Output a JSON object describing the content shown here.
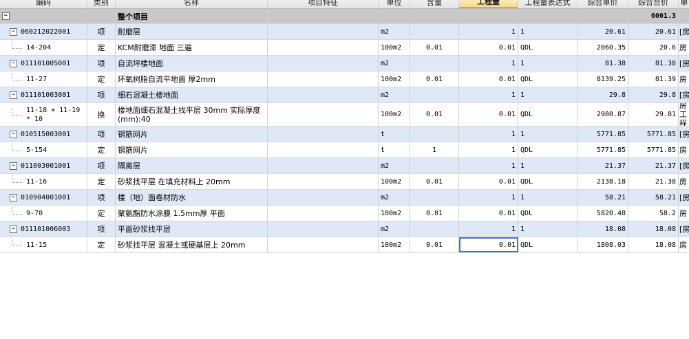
{
  "header": {
    "columns": [
      "编码",
      "类别",
      "名称",
      "项目特征",
      "单位",
      "含量",
      "工程量",
      "工程量表达式",
      "综合单价",
      "综合合价",
      "单"
    ],
    "selected_index": 6
  },
  "project_row": {
    "toggle": "−",
    "name": "整个项目",
    "total": "6001.3"
  },
  "rows": [
    {
      "level": 1,
      "code": "060212022001",
      "type": "项",
      "name": "耐磨层",
      "feature": "",
      "unit": "m2",
      "content": "",
      "qty": "1",
      "expr": "1",
      "price": "20.61",
      "total": "20.61",
      "extra": "[房"
    },
    {
      "level": 2,
      "code": "14-204",
      "type": "定",
      "name": "KCM耐磨漆 地面 三遍",
      "feature": "",
      "unit": "100m2",
      "content": "0.01",
      "qty": "0.01",
      "expr": "QDL",
      "price": "2060.35",
      "total": "20.6",
      "extra": "房"
    },
    {
      "level": 1,
      "code": "011101005001",
      "type": "项",
      "name": "自流坪楼地面",
      "feature": "",
      "unit": "m2",
      "content": "",
      "qty": "1",
      "expr": "1",
      "price": "81.38",
      "total": "81.38",
      "extra": "[房"
    },
    {
      "level": 2,
      "code": "11-27",
      "type": "定",
      "name": "环氧树脂自流平地面 厚2mm",
      "feature": "",
      "unit": "100m2",
      "content": "0.01",
      "qty": "0.01",
      "expr": "QDL",
      "price": "8139.25",
      "total": "81.39",
      "extra": "房"
    },
    {
      "level": 1,
      "code": "011101003001",
      "type": "项",
      "name": "细石混凝土楼地面",
      "feature": "",
      "unit": "m2",
      "content": "",
      "qty": "1",
      "expr": "1",
      "price": "29.8",
      "total": "29.8",
      "extra": "[房"
    },
    {
      "level": 2,
      "tall": true,
      "code": "11-18 + 11-19 * 10",
      "type": "换",
      "name": "楼地面细石混凝土找平层 30mm  实际厚度(mm):40",
      "feature": "",
      "unit": "100m2",
      "content": "0.01",
      "qty": "0.01",
      "expr": "QDL",
      "price": "2980.87",
      "total": "29.81",
      "extra": "房工程"
    },
    {
      "level": 1,
      "code": "010515003001",
      "type": "项",
      "name": "钢筋网片",
      "feature": "",
      "unit": "t",
      "content": "",
      "qty": "1",
      "expr": "1",
      "price": "5771.85",
      "total": "5771.85",
      "extra": "[房"
    },
    {
      "level": 2,
      "code": "5-154",
      "type": "定",
      "name": "钢筋网片",
      "feature": "",
      "unit": "t",
      "content": "1",
      "qty": "1",
      "expr": "QDL",
      "price": "5771.85",
      "total": "5771.85",
      "extra": "房"
    },
    {
      "level": 1,
      "code": "011003001001",
      "type": "项",
      "name": "隔离层",
      "feature": "",
      "unit": "m2",
      "content": "",
      "qty": "1",
      "expr": "1",
      "price": "21.37",
      "total": "21.37",
      "extra": "[房"
    },
    {
      "level": 2,
      "code": "11-16",
      "type": "定",
      "name": "砂浆找平层 在填充材料上 20mm",
      "feature": "",
      "unit": "100m2",
      "content": "0.01",
      "qty": "0.01",
      "expr": "QDL",
      "price": "2138.18",
      "total": "21.38",
      "extra": "房"
    },
    {
      "level": 1,
      "code": "010904001001",
      "type": "项",
      "name": "楼（地）面卷材防水",
      "feature": "",
      "unit": "m2",
      "content": "",
      "qty": "1",
      "expr": "1",
      "price": "58.21",
      "total": "58.21",
      "extra": "[房"
    },
    {
      "level": 2,
      "code": "9-70",
      "type": "定",
      "name": "聚氨酯防水涂膜 1.5mm厚 平面",
      "feature": "",
      "unit": "100m2",
      "content": "0.01",
      "qty": "0.01",
      "expr": "QDL",
      "price": "5820.48",
      "total": "58.2",
      "extra": "房"
    },
    {
      "level": 1,
      "code": "011101006003",
      "type": "项",
      "name": "平面砂浆找平层",
      "feature": "",
      "unit": "m2",
      "content": "",
      "qty": "1",
      "expr": "1",
      "price": "18.08",
      "total": "18.08",
      "extra": "[房"
    },
    {
      "level": 2,
      "active": true,
      "code": "11-15",
      "type": "定",
      "name": "砂浆找平层 混凝土或硬基层上 20mm",
      "feature": "",
      "unit": "100m2",
      "content": "0.01",
      "qty": "0.01",
      "expr": "QDL",
      "price": "1808.03",
      "total": "18.08",
      "extra": "房"
    }
  ]
}
